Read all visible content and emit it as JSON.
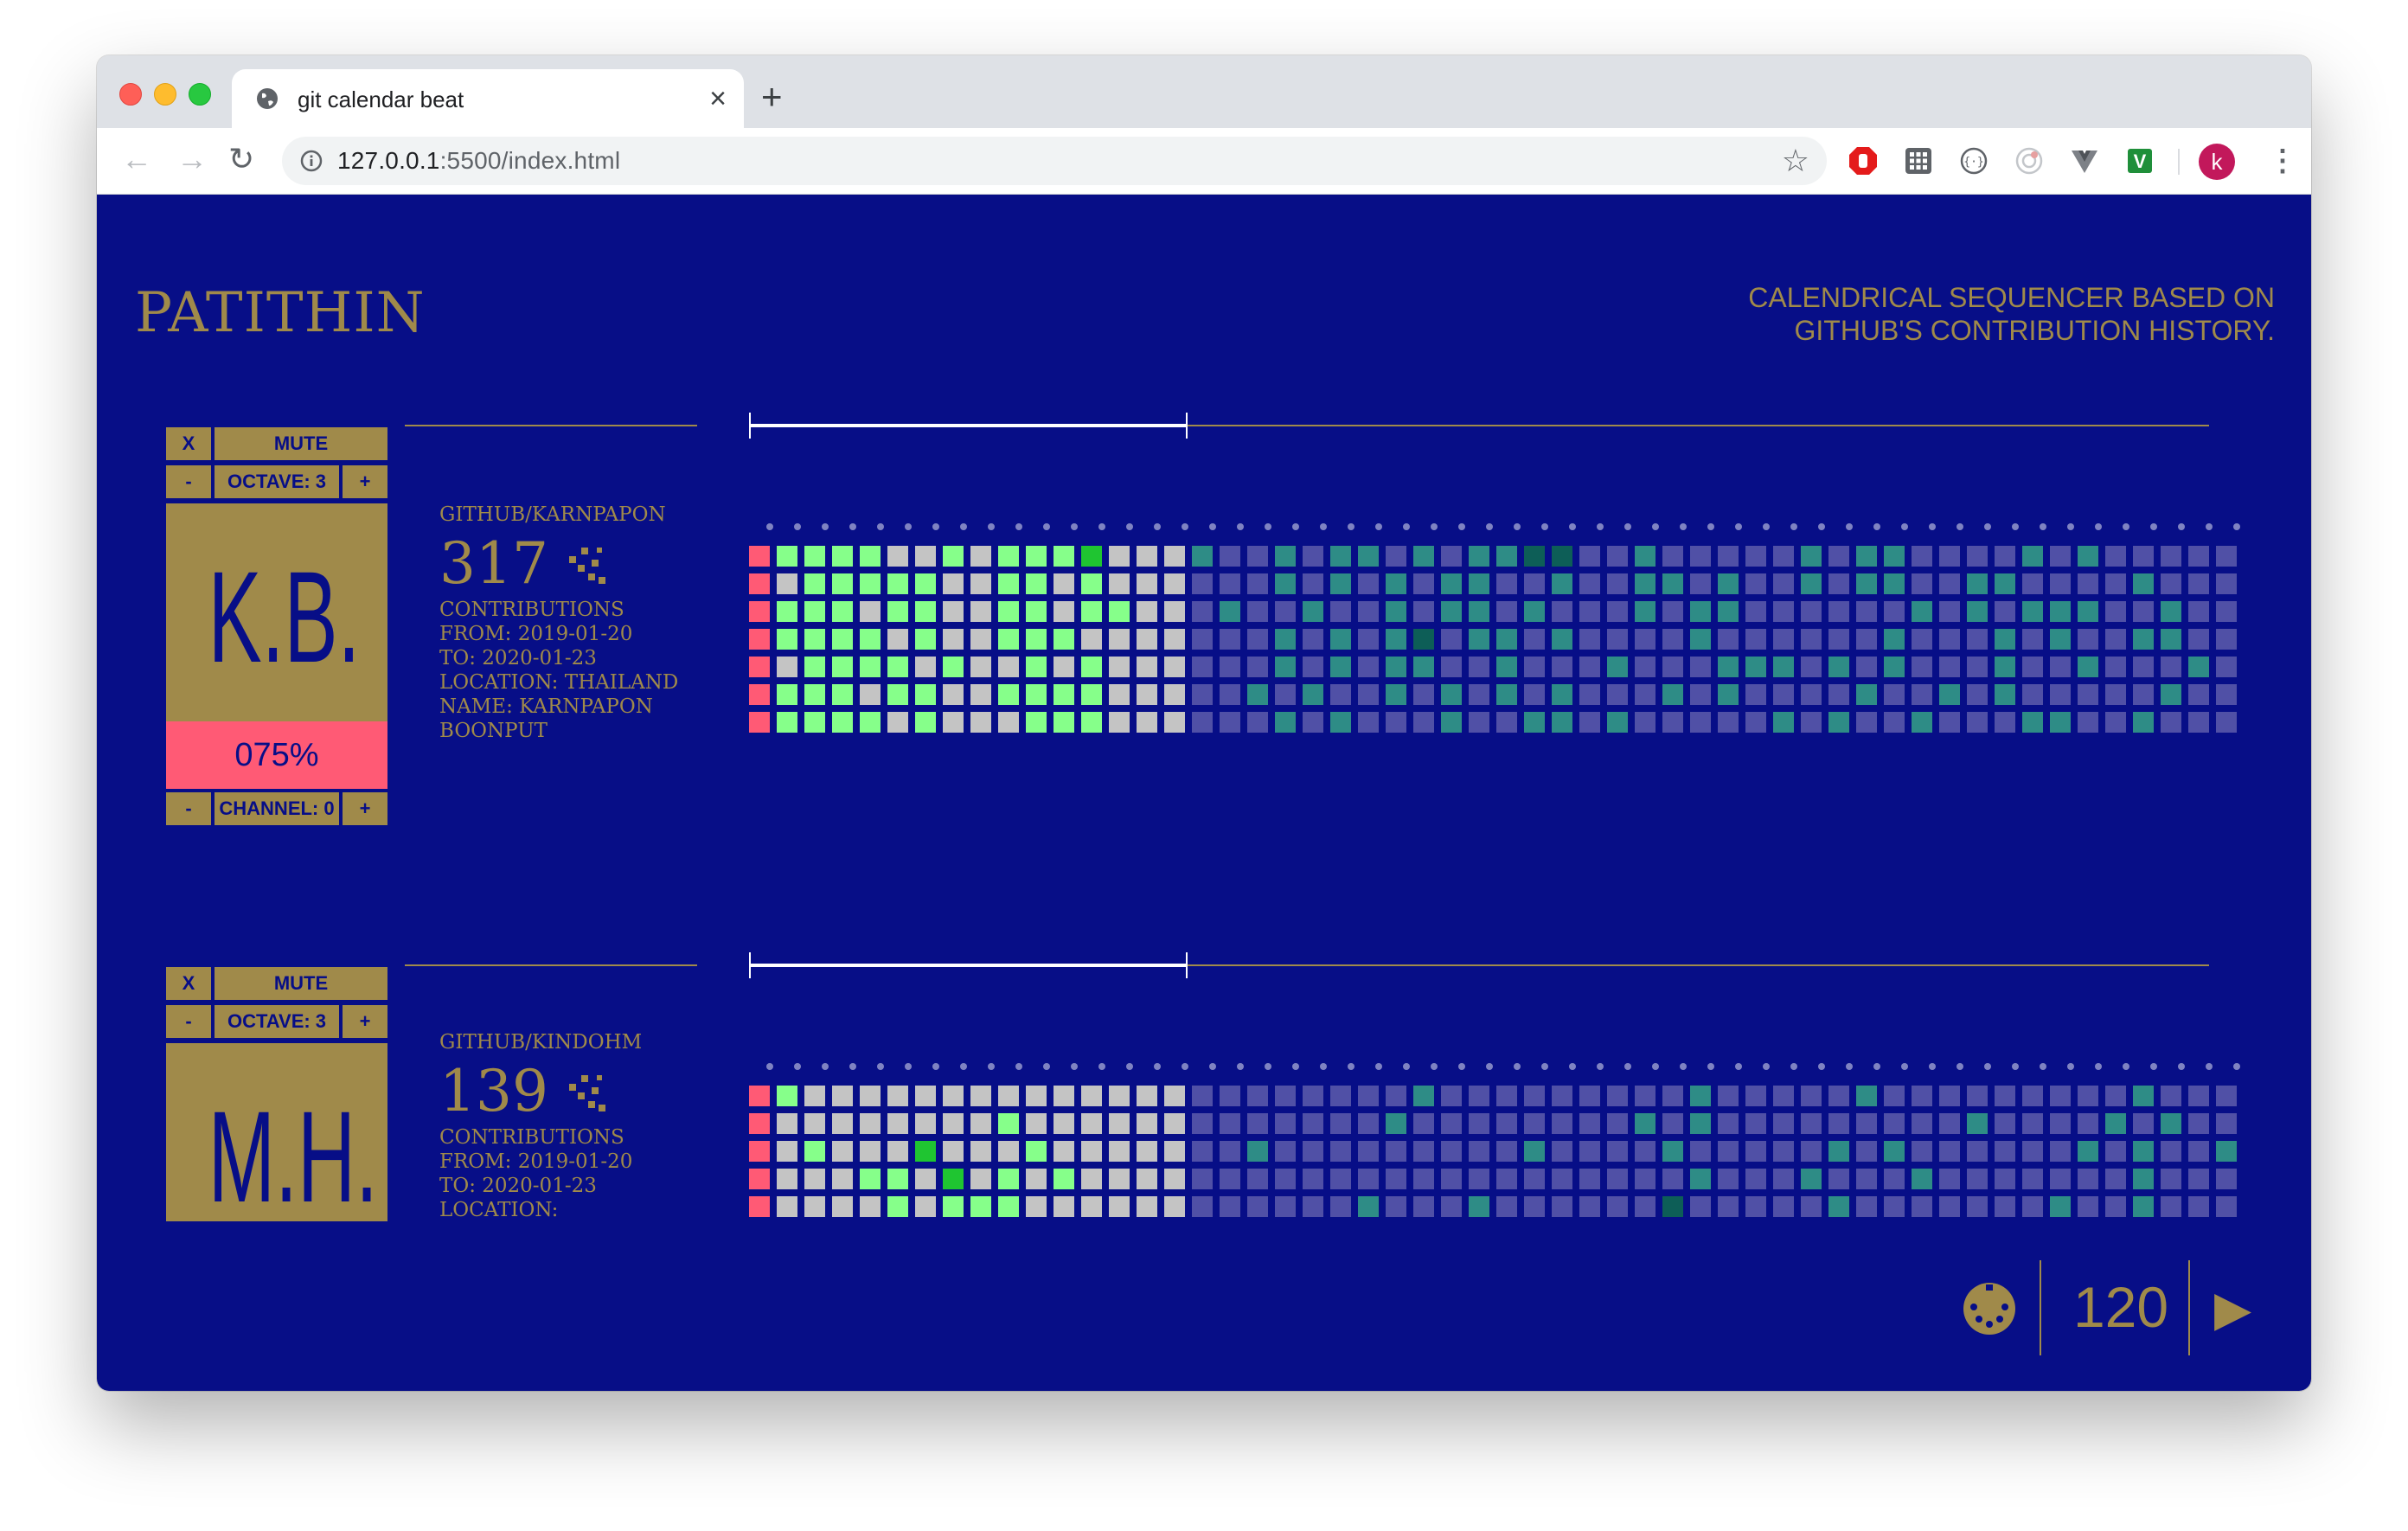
{
  "browser": {
    "tab_title": "git calendar beat",
    "new_tab_symbol": "+",
    "url_host": "127.0.0.1",
    "url_rest": ":5500/index.html",
    "profile_initial": "k"
  },
  "page": {
    "brand": "PATITHIN",
    "tagline_line1": "CALENDRICAL SEQUENCER BASED ON",
    "tagline_line2": "GITHUB'S CONTRIBUTION HISTORY.",
    "bpm": "120",
    "colors": {
      "background": "#070e87",
      "gold": "#a08a4a",
      "pink": "#ff5a75",
      "lightgreen": "#86ff8a",
      "green": "#1fc531",
      "gray": "#c4c4c4",
      "empty": "#5050a6",
      "teal": "#2e8c86",
      "darkteal": "#0d5e57"
    }
  },
  "tracks": [
    {
      "remove_label": "X",
      "mute_label": "MUTE",
      "octave_label": "OCTAVE: 3",
      "minus": "-",
      "plus": "+",
      "initials": "K.B.",
      "velocity": "075%",
      "channel_label": "CHANNEL: 0",
      "username": "GITHUB/KARNPAPON",
      "contributions": "317",
      "meta_lines": [
        "CONTRIBUTIONS",
        "FROM: 2019-01-20",
        "TO: 2020-01-23",
        "LOCATION: THAILAND",
        "NAME: KARNPAPON",
        "BOONPUT"
      ],
      "progress": 0.3,
      "playhead_week": 0,
      "played_weeks": 16,
      "grid": [
        "LLLLNNLNLLLGNN",
        "NLLLLLNNLLNLNN",
        "LLLNLLNNLLNLLN",
        "LLLLNLNNLLLNNN",
        "NLLLLNLNNLNLNN",
        "LLLNLLNNLLLLNN",
        "LLLLNLNNNLLLNN"
      ],
      "future": [
        "T..T.TT.T.TTDD..T.....T.TT....T.T...........T.....TT.....D",
        "...T.T.T.TT..T..TT.T..T.TT..TT....T....T.....T..T.......TT",
        ".T..T..T.TT.T...T.TT......T.T.TTT..T...T.T...T.TT.....T.TT",
        "...T.T.TD.TT.T....T......T...T.T..TT....T......T.....TT..D",
        "...T.T.TT..T...T...TTT.T.T...T..T...T.T.T...T.T.T.T...D..D",
        "..T.T..T.T.T.T...T.T....T..T.T.....T...T.T.T...T.T..T.T.TD",
        "...T.T...T..TT.T.....T.T..T...TT..T...T...T...T.T.....TD. "
      ]
    },
    {
      "remove_label": "X",
      "mute_label": "MUTE",
      "octave_label": "OCTAVE: 3",
      "minus": "-",
      "plus": "+",
      "initials": "M.H.",
      "username": "GITHUB/KINDOHM",
      "contributions": "139",
      "meta_lines": [
        "CONTRIBUTIONS",
        "FROM: 2019-01-20",
        "TO: 2020-01-23",
        "LOCATION:"
      ],
      "progress": 0.3,
      "playhead_week": 0,
      "played_weeks": 16,
      "grid": [
        "LNNNNNNNNNNNNN",
        "NNNNNNNNLNNNNN",
        "NLNNNGNNNLNNNN",
        "NNNLLNGNLNLNNN",
        "NNNNLNLLLNNNNN"
      ],
      "future": [
        "........T.........T.....T.........T.....T.........",
        ".......T........T.T.........T....T.T.....T.T......",
        "..T.........T....T.....T.T......T.T..T..T...T.....",
        "..................T...T...T.......T.......T...T...",
        "......T...T......D.....T.......T..T....T....D....."
      ]
    }
  ]
}
